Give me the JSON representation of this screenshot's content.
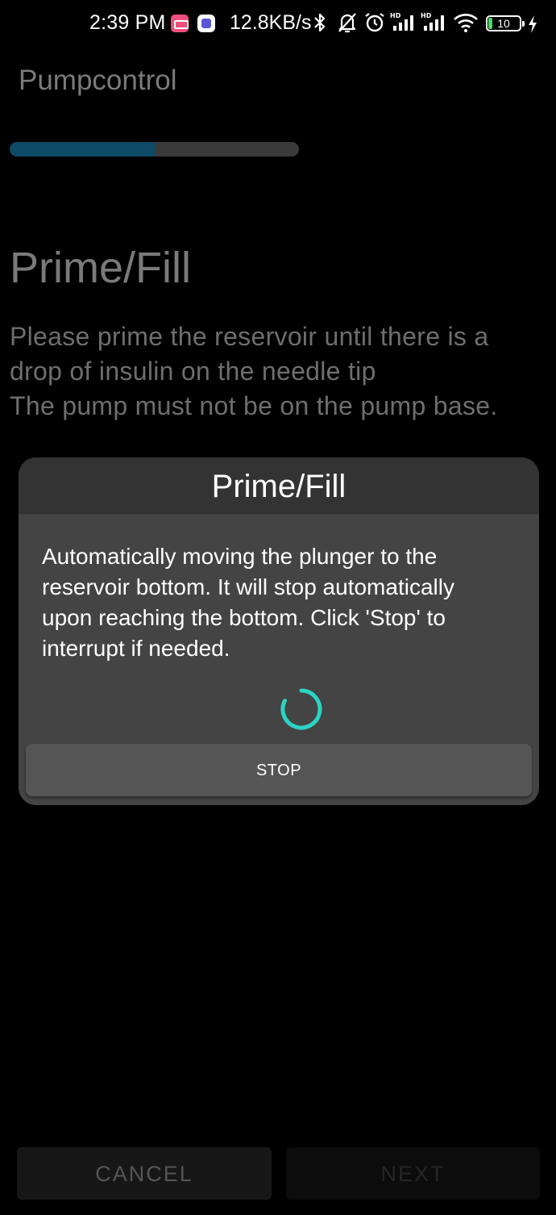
{
  "status_bar": {
    "time": "2:39 PM",
    "net_speed": "12.8KB/s",
    "battery_level": "10",
    "icons": [
      "bilibili-app-icon",
      "notes-app-icon",
      "bluetooth-icon",
      "bell-off-icon",
      "alarm-icon",
      "hd-signal-icon",
      "hd-signal-icon",
      "wifi-icon",
      "battery-icon",
      "charging-icon"
    ]
  },
  "app": {
    "title": "Pumpcontrol",
    "progress_fraction": 0.5
  },
  "step": {
    "title": "Prime/Fill",
    "description_lines": [
      "Please prime the reservoir until there is a",
      "drop of insulin on the needle tip",
      "The pump must not be on the pump base."
    ]
  },
  "dialog": {
    "title": "Prime/Fill",
    "message_lines": [
      "Automatically moving the plunger to the",
      "reservoir bottom. It will stop automatically",
      "upon reaching the bottom. Click 'Stop' to",
      "interrupt if needed."
    ],
    "stop_label": "STOP",
    "spinner_color": "#2bd4c4"
  },
  "buttons": {
    "cancel_label": "CANCEL",
    "next_label": "NEXT"
  }
}
